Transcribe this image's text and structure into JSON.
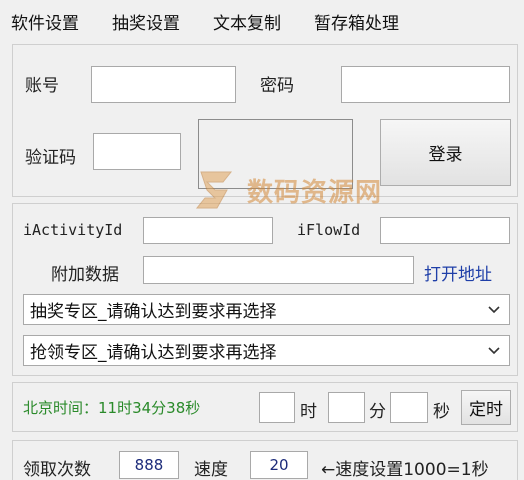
{
  "menu": [
    "软件设置",
    "抽奖设置",
    "文本复制",
    "暂存箱处理"
  ],
  "login": {
    "account_label": "账号",
    "password_label": "密码",
    "captcha_label": "验证码",
    "login_button": "登录",
    "account_value": "",
    "password_value": "",
    "captcha_value": ""
  },
  "activity": {
    "iactivityid_label": "iActivityId",
    "iflowid_label": "iFlowId",
    "extra_label": "附加数据",
    "open_link": "打开地址",
    "dropdown1": "抽奖专区_请确认达到要求再选择",
    "dropdown2": "抢领专区_请确认达到要求再选择"
  },
  "timer": {
    "beijing_time": "北京时间：11时34分38秒",
    "hour_unit": "时",
    "minute_unit": "分",
    "second_unit": "秒",
    "timer_button": "定时"
  },
  "bottom": {
    "count_label": "领取次数",
    "count_value": "888",
    "speed_label": "速度",
    "speed_value": "20",
    "speed_note": "←速度设置1000=1秒"
  },
  "watermark": "数码资源网",
  "colors": {
    "time_green": "#2a8a2a",
    "link_blue": "#1f3fa8",
    "value_blue": "#1c2b7a"
  }
}
